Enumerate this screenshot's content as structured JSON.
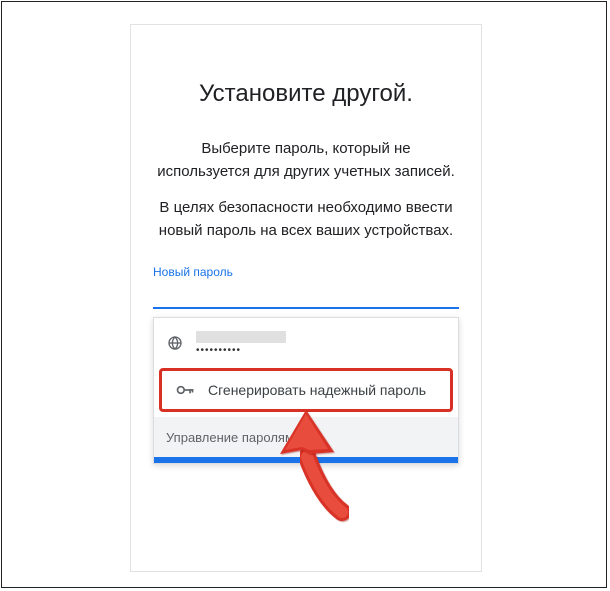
{
  "title": "Установите другой.",
  "desc1": "Выберите пароль, который не используется для других учетных записей.",
  "desc2": "В целях безопасности необходимо ввести новый пароль на всех ваших устройствах.",
  "field_label": "Новый пароль",
  "saved_dots": "••••••••••",
  "generate_label": "Сгенерировать надежный пароль",
  "manage_label": "Управление паролями",
  "colors": {
    "accent": "#1a73e8",
    "highlight": "#d93025"
  }
}
